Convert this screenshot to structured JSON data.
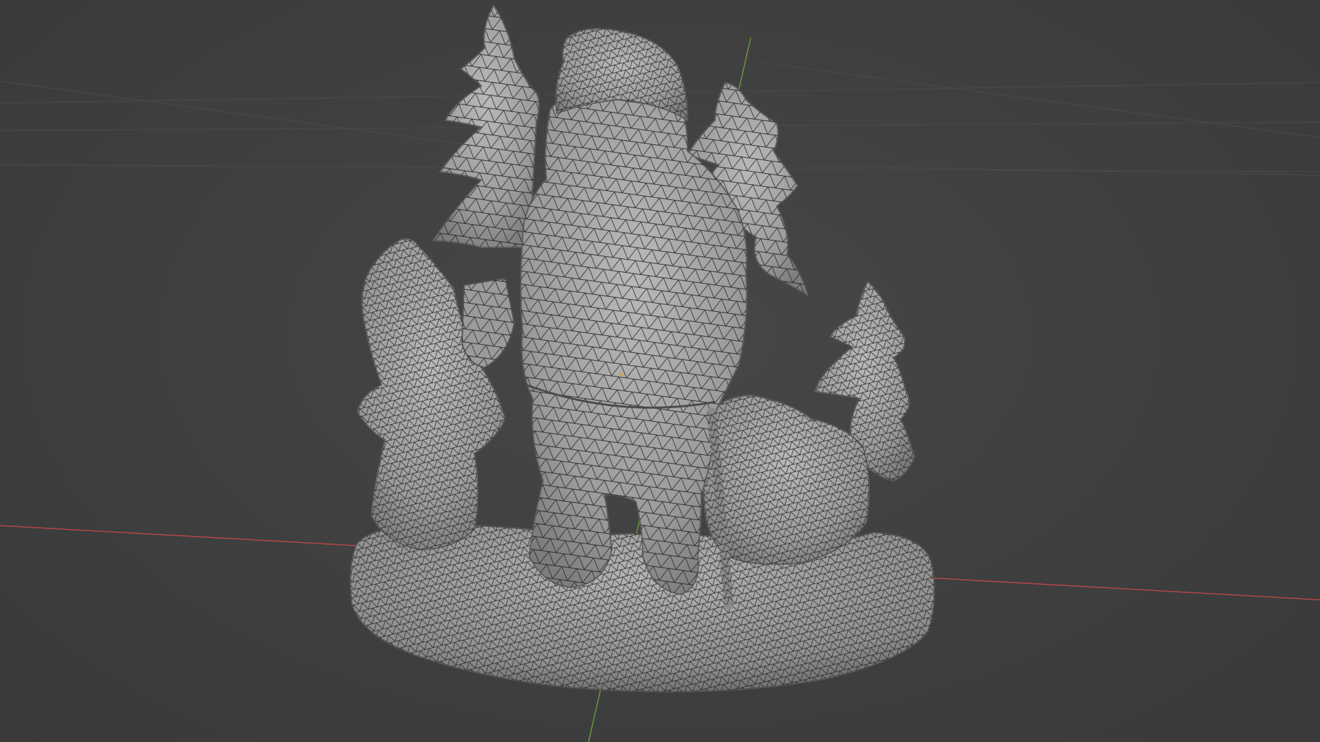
{
  "viewport": {
    "background_color": "#3d3d3d",
    "grid_color": "#4a4a4a",
    "x_axis_color": "#c04a4a",
    "y_axis_color": "#6a9a3a",
    "mesh_fill_color": "#a8a8a8",
    "wire_color": "#1c1c1c",
    "origin_dot_color": "#e0a030",
    "shading": "solid-wireframe"
  },
  "model": {
    "subject": "figurine-santa-with-children-and-pine-trees",
    "parts": [
      "pine-tree-left",
      "pine-tree-right",
      "pine-tree-small-right",
      "santa-body",
      "santa-hat",
      "child-left",
      "lantern",
      "child-right-sack",
      "snow-base"
    ]
  }
}
